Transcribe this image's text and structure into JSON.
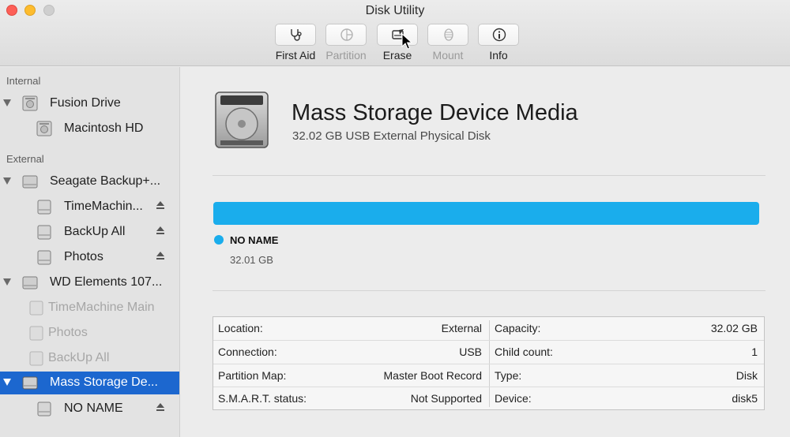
{
  "window": {
    "title": "Disk Utility"
  },
  "toolbar": {
    "buttons": [
      {
        "label": "First Aid",
        "icon": "stethoscope-icon",
        "enabled": true
      },
      {
        "label": "Partition",
        "icon": "pie-chart-icon",
        "enabled": false
      },
      {
        "label": "Erase",
        "icon": "erase-disk-icon",
        "enabled": true
      },
      {
        "label": "Mount",
        "icon": "mount-icon",
        "enabled": false
      },
      {
        "label": "Info",
        "icon": "info-icon",
        "enabled": true
      }
    ]
  },
  "sidebar": {
    "internal_header": "Internal",
    "external_header": "External",
    "items": [
      {
        "name": "Fusion Drive"
      },
      {
        "name": "Macintosh HD"
      },
      {
        "name": "Seagate Backup+..."
      },
      {
        "name": "TimeMachin...",
        "ejectable": true
      },
      {
        "name": "BackUp All",
        "ejectable": true
      },
      {
        "name": "Photos",
        "ejectable": true
      },
      {
        "name": "WD Elements 107..."
      },
      {
        "name": "TimeMachine Main",
        "state": "unmounted"
      },
      {
        "name": "Photos",
        "state": "unmounted"
      },
      {
        "name": "BackUp All",
        "state": "unmounted"
      },
      {
        "name": "Mass Storage De...",
        "state": "selected"
      },
      {
        "name": "NO NAME",
        "ejectable": true
      }
    ]
  },
  "device": {
    "title": "Mass Storage Device Media",
    "subtitle": "32.02 GB USB External Physical Disk",
    "usage_fraction": 1.0,
    "partition_name": "NO NAME",
    "partition_size": "32.01 GB",
    "color": "#1aadec"
  },
  "info": {
    "rows": [
      {
        "k1": "Location:",
        "v1": "External",
        "k2": "Capacity:",
        "v2": "32.02 GB"
      },
      {
        "k1": "Connection:",
        "v1": "USB",
        "k2": "Child count:",
        "v2": "1"
      },
      {
        "k1": "Partition Map:",
        "v1": "Master Boot Record",
        "k2": "Type:",
        "v2": "Disk"
      },
      {
        "k1": "S.M.A.R.T. status:",
        "v1": "Not Supported",
        "k2": "Device:",
        "v2": "disk5"
      }
    ]
  }
}
